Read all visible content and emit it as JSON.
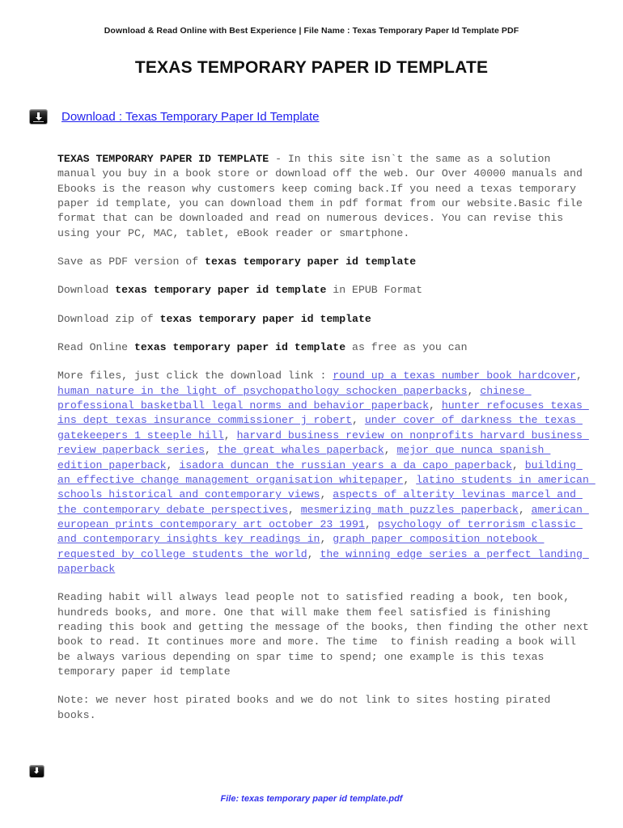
{
  "header": {
    "text": "Download & Read Online with Best Experience | File Name : Texas Temporary Paper Id Template PDF"
  },
  "title": "TEXAS TEMPORARY PAPER ID TEMPLATE",
  "download": {
    "icon": "download-icon",
    "link_label": "Download : Texas Temporary Paper Id Template"
  },
  "intro": {
    "lead": "TEXAS TEMPORARY PAPER ID TEMPLATE",
    "body": " - In this site isn`t the same as a solution manual you buy in a book store or download off the web. Our Over 40000 manuals and Ebooks is the reason why customers keep coming back.If you need a texas temporary paper id template, you can download them in pdf format from our website.Basic file format that can be downloaded and read on numerous devices. You can revise this using your PC, MAC, tablet, eBook reader or smartphone."
  },
  "formats": [
    {
      "pre": "Save as PDF version of ",
      "strong": "texas temporary paper id template",
      "post": ""
    },
    {
      "pre": "Download ",
      "strong": "texas temporary paper id template",
      "post": " in EPUB Format"
    },
    {
      "pre": "Download zip of ",
      "strong": "texas temporary paper id template",
      "post": ""
    },
    {
      "pre": "Read Online ",
      "strong": "texas temporary paper id template",
      "post": " as free as you can"
    }
  ],
  "more_files": {
    "intro": "More files, just click the download link : ",
    "links": [
      "round up a texas number book hardcover",
      "human nature in the light of psychopathology schocken paperbacks",
      "chinese professional basketball legal norms and behavior paperback",
      "hunter refocuses texas ins dept texas insurance commissioner j robert",
      "under cover of darkness the texas gatekeepers 1 steeple hill",
      "harvard business review on nonprofits harvard business review paperback series",
      "the great whales paperback",
      "mejor que nunca spanish edition paperback",
      "isadora duncan the russian years a da capo paperback",
      "building an effective change management organisation whitepaper",
      "latino students in american schools historical and contemporary views",
      "aspects of alterity levinas marcel and the contemporary debate perspectives",
      "mesmerizing math puzzles paperback",
      "american european prints contemporary art october 23 1991",
      "psychology of terrorism classic and contemporary insights key readings in",
      "graph paper composition notebook requested by college students the world",
      "the winning edge series a perfect landing paperback"
    ],
    "separator": ", "
  },
  "reading_habit": "Reading habit will always lead people not to satisfied reading a book, ten book, hundreds books, and more. One that will make them feel satisfied is finishing reading this book and getting the message of the books, then finding the other next book to read. It continues more and more. The time  to finish reading a book will be always various depending on spar time to spend; one example is this texas temporary paper id template",
  "note": "Note: we never host pirated books and we do not link to sites hosting pirated books.",
  "footer": {
    "icon": "download-icon",
    "text": "File: texas temporary paper id template.pdf"
  },
  "colors": {
    "main_link": "#2222ee",
    "inline_link": "#5a5ae0",
    "footer_text": "#3333ee",
    "body_text": "#595959"
  }
}
